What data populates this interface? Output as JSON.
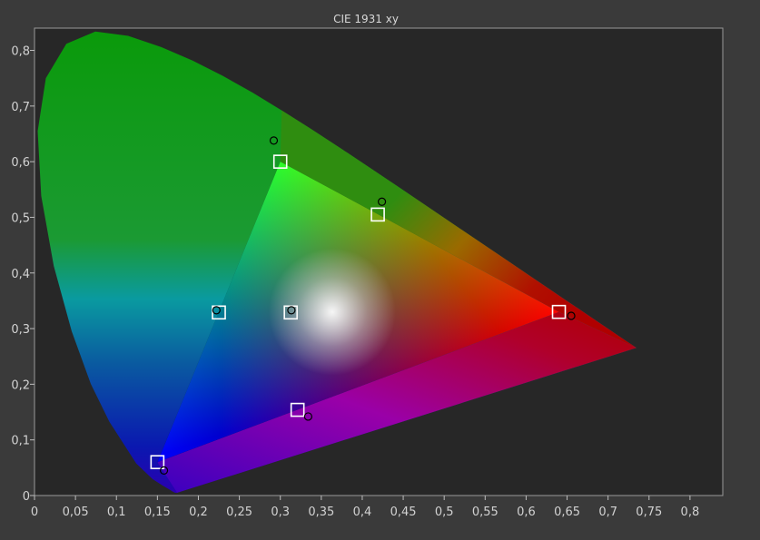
{
  "chart_data": {
    "type": "scatter",
    "title": "CIE 1931 xy",
    "xlabel": "",
    "ylabel": "",
    "xlim": [
      0,
      0.84
    ],
    "ylim": [
      0,
      0.84
    ],
    "grid": false,
    "background": "#272727",
    "outer_background": "#3a3a3a",
    "x_ticks": [
      "0",
      "0,05",
      "0,1",
      "0,15",
      "0,2",
      "0,25",
      "0,3",
      "0,35",
      "0,4",
      "0,45",
      "0,5",
      "0,55",
      "0,6",
      "0,65",
      "0,7",
      "0,75",
      "0,8"
    ],
    "y_ticks": [
      "0",
      "0,1",
      "0,2",
      "0,3",
      "0,4",
      "0,5",
      "0,6",
      "0,7",
      "0,8"
    ],
    "gamut_triangle": [
      [
        0.64,
        0.33
      ],
      [
        0.3,
        0.6
      ],
      [
        0.15,
        0.06
      ]
    ],
    "series": [
      {
        "marker": "square",
        "color": "#ffffff",
        "points": [
          {
            "x": 0.64,
            "y": 0.33
          },
          {
            "x": 0.3,
            "y": 0.6
          },
          {
            "x": 0.15,
            "y": 0.06
          },
          {
            "x": 0.225,
            "y": 0.329
          },
          {
            "x": 0.321,
            "y": 0.154
          },
          {
            "x": 0.419,
            "y": 0.505
          },
          {
            "x": 0.3127,
            "y": 0.329
          }
        ]
      },
      {
        "marker": "circle",
        "color": "#000000",
        "points": [
          {
            "x": 0.655,
            "y": 0.323
          },
          {
            "x": 0.292,
            "y": 0.638
          },
          {
            "x": 0.158,
            "y": 0.045
          },
          {
            "x": 0.222,
            "y": 0.333
          },
          {
            "x": 0.334,
            "y": 0.142
          },
          {
            "x": 0.424,
            "y": 0.528
          },
          {
            "x": 0.3135,
            "y": 0.333
          }
        ]
      }
    ]
  }
}
